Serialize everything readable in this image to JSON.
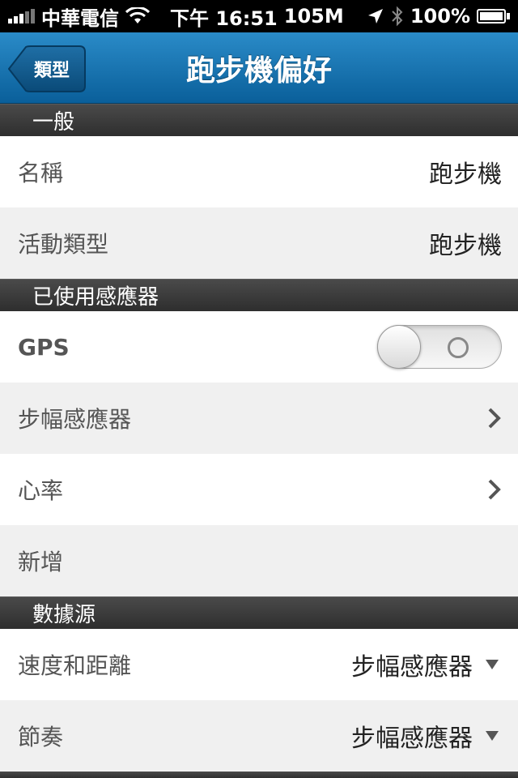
{
  "status_bar": {
    "carrier": "中華電信",
    "time": "下午 16:51",
    "data": "105M",
    "battery": "100%"
  },
  "nav": {
    "back_label": "類型",
    "title": "跑步機偏好"
  },
  "sections": {
    "general": {
      "header": "一般",
      "name_label": "名稱",
      "name_value": "跑步機",
      "activity_label": "活動類型",
      "activity_value": "跑步機"
    },
    "sensors": {
      "header": "已使用感應器",
      "gps_label": "GPS",
      "gps_on": false,
      "footpod_label": "步幅感應器",
      "heart_label": "心率",
      "add_label": "新增"
    },
    "data_source": {
      "header": "數據源",
      "speed_label": "速度和距離",
      "speed_value": "步幅感應器",
      "cadence_label": "節奏",
      "cadence_value": "步幅感應器"
    }
  },
  "colors": {
    "nav_top": "#2a8bc8",
    "nav_bottom": "#0a5f9a",
    "section_header": "#3a3a3a"
  }
}
